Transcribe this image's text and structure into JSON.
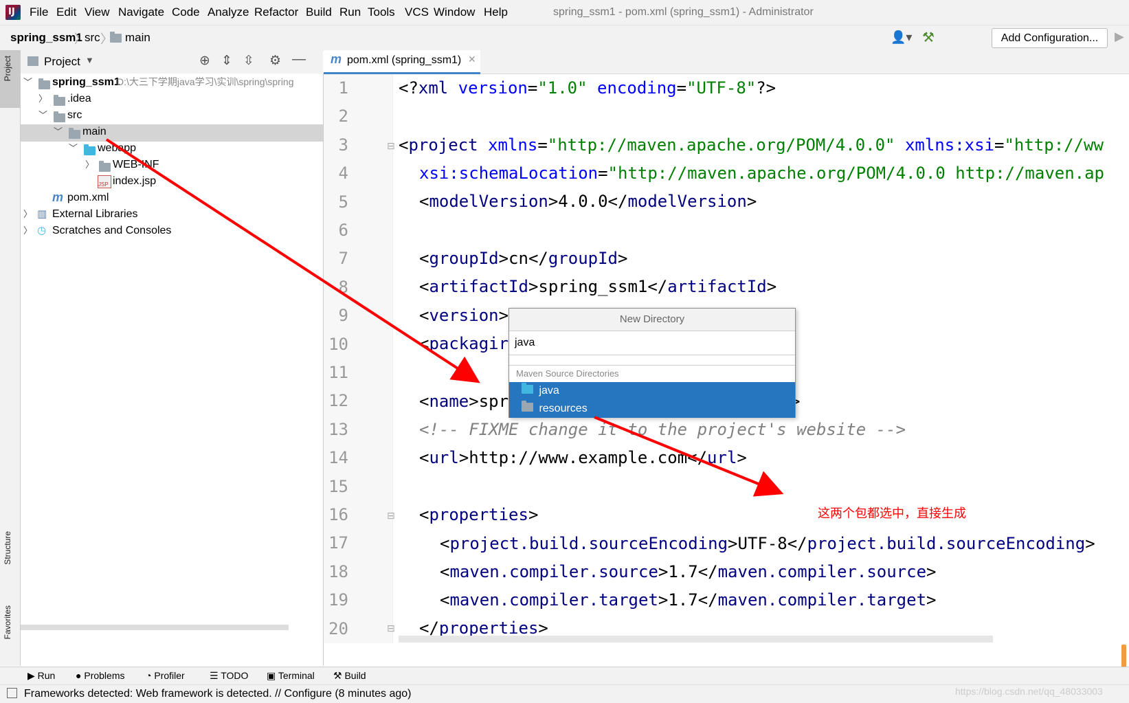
{
  "menu": {
    "items": [
      "File",
      "Edit",
      "View",
      "Navigate",
      "Code",
      "Analyze",
      "Refactor",
      "Build",
      "Run",
      "Tools",
      "VCS",
      "Window",
      "Help"
    ],
    "window_title": "spring_ssm1 - pom.xml (spring_ssm1) - Administrator"
  },
  "navbar": {
    "crumbs": [
      "spring_ssm1",
      "src",
      "main"
    ],
    "add_configuration": "Add Configuration..."
  },
  "side_tabs": {
    "project": "Project",
    "structure": "Structure",
    "favorites": "Favorites"
  },
  "project_panel": {
    "title": "Project",
    "tree": [
      {
        "label": "spring_ssm1",
        "path": "D:\\大三下学期java学习\\实训\\spring\\spring"
      },
      {
        "label": ".idea"
      },
      {
        "label": "src"
      },
      {
        "label": "main"
      },
      {
        "label": "webapp"
      },
      {
        "label": "WEB-INF"
      },
      {
        "label": "index.jsp"
      },
      {
        "label": "pom.xml"
      },
      {
        "label": "External Libraries"
      },
      {
        "label": "Scratches and Consoles"
      }
    ]
  },
  "editor": {
    "tab": "pom.xml (spring_ssm1)",
    "line_numbers": [
      "1",
      "2",
      "3",
      "4",
      "5",
      "6",
      "7",
      "8",
      "9",
      "10",
      "11",
      "12",
      "13",
      "14",
      "15",
      "16",
      "17",
      "18",
      "19",
      "20"
    ]
  },
  "popup": {
    "title": "New Directory",
    "input_value": "java",
    "group": "Maven Source Directories",
    "items": [
      "java",
      "resources"
    ]
  },
  "annotation": "这两个包都选中，直接生成",
  "bottom_tools": [
    "Run",
    "Problems",
    "Profiler",
    "TODO",
    "Terminal",
    "Build"
  ],
  "status": "Frameworks detected: Web framework is detected. // Configure (8 minutes ago)",
  "watermark": "https://blog.csdn.net/qq_48033003",
  "colors": {
    "selection": "#2675bf",
    "tag": "#000080",
    "attr": "#0000ff",
    "string": "#008000",
    "annotation": "#ff0000"
  }
}
